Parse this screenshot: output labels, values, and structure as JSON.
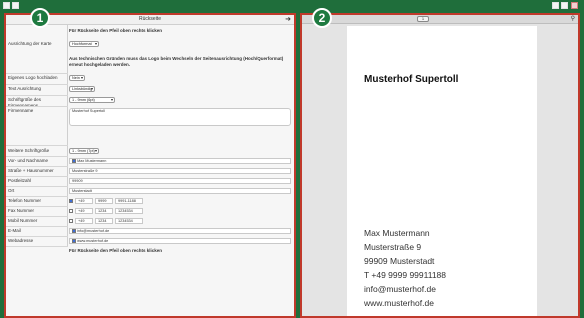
{
  "left_panel": {
    "title": "Rückseite",
    "note_top": "Für Rückseite den Pfeil oben rechts klicken",
    "note_bottom": "Für Rückseite den Pfeil oben rechts klicken",
    "orientation_label": "Ausrichtung der Karte",
    "orientation_value": "Hochformat",
    "orientation_warning": "Aus technischen Gründen muss das Logo beim Wechseln der Seitenausrichtung (Hoch/Querformat) erneut hochgeladen werden.",
    "own_logo_label": "Eigenes Logo hochladen",
    "own_logo_value": "Nein",
    "text_align_label": "Text Ausrichtung",
    "text_align_value": "Linksbündig",
    "font_size_company_label": "Schriftgröße des Firmennamens",
    "font_size_company_value": "1 - 9mm (6pt)",
    "company_label": "Firmenname",
    "company_value": "Musterhof Supertoll",
    "more_font_label": "Weitere Schriftgröße",
    "more_font_value": "1 - 9mm (7pt)",
    "name_label": "Vor- und Nachname",
    "name_value": "Max Mustermann",
    "street_label": "Straße + Hausnummer",
    "street_value": "Musterstraße 9",
    "zip_label": "Postleitzahl",
    "zip_value": "99909",
    "city_label": "Ort",
    "city_value": "Musterstadt",
    "phone_label": "Telefon Nummer",
    "phone_parts": [
      "+49",
      "9999",
      "9991-1188"
    ],
    "fax_label": "Fax Nummer",
    "fax_parts": [
      "+49",
      "1234",
      "1234534"
    ],
    "mobile_label": "Mobil Nummer",
    "mobile_parts": [
      "+49",
      "1234",
      "1234534"
    ],
    "email_label": "E-Mail",
    "email_value": "info@musterhof.de",
    "web_label": "Webadresse",
    "web_value": "www.musterhof.de"
  },
  "right_panel": {
    "page_indicator": "1",
    "card": {
      "company": "Musterhof Supertoll",
      "lines": [
        "Max Mustermann",
        "Musterstraße 9",
        "99909 Musterstadt",
        "T +49 9999 99911188",
        "info@musterhof.de",
        "www.musterhof.de"
      ]
    }
  },
  "badges": {
    "one": "1",
    "two": "2"
  },
  "colors": {
    "background": "#1f6e3b",
    "panel_border": "#c0392b",
    "badge": "#1e7a40"
  }
}
